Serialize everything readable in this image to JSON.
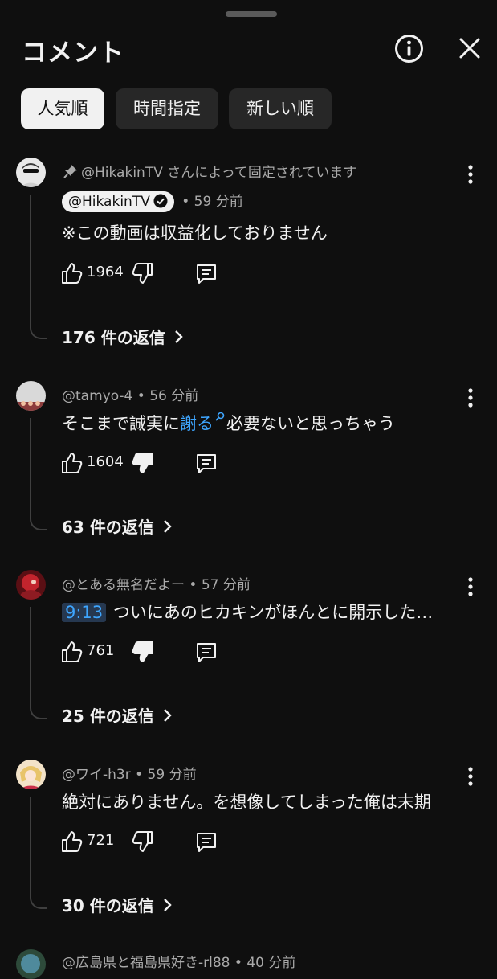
{
  "panel": {
    "title": "コメント"
  },
  "sort_tabs": [
    {
      "label": "人気順"
    },
    {
      "label": "時間指定"
    },
    {
      "label": "新しい順"
    }
  ],
  "comments": [
    {
      "pinned_text": "@HikakinTV さんによって固定されています",
      "author": "@HikakinTV",
      "time": "• 59 分前",
      "text": "※この動画は収益化しておりません",
      "likes": "1964",
      "replies": "176 件の返信"
    },
    {
      "author_time": "@tamyo-4 • 56 分前",
      "text_before": "そこまで誠実に",
      "link": "謝る",
      "text_after": "必要ないと思っちゃう",
      "likes": "1604",
      "replies": "63 件の返信"
    },
    {
      "author_time": "@とある無名だよー • 57 分前",
      "timestamp": "9:13",
      "text": "ついにあのヒカキンがほんとに開示した…",
      "likes": "761",
      "replies": "25 件の返信"
    },
    {
      "author_time": "@ワイ-h3r • 59 分前",
      "text": "絶対にありません。を想像してしまった俺は末期",
      "likes": "721",
      "replies": "30 件の返信"
    },
    {
      "author_time": "@広島県と福島県好き-rl88 • 40 分前"
    }
  ]
}
